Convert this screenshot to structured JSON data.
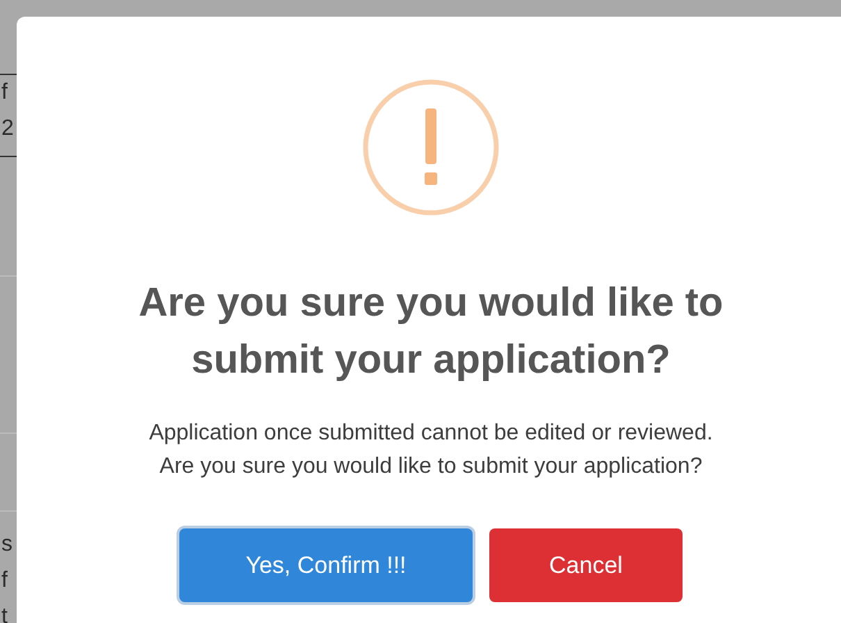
{
  "background_upper_fragments": [
    "f",
    "2"
  ],
  "background_lower_fragments": [
    "s",
    "f",
    "t"
  ],
  "dialog": {
    "title": "Are you sure you would like to submit your application?",
    "message": [
      "Application once submitted cannot be edited or reviewed.",
      "Are you sure you would like to submit your application?"
    ],
    "buttons": [
      {
        "label": "Yes, Confirm !!!",
        "kind": "confirm",
        "focused": true
      },
      {
        "label": "Cancel",
        "kind": "cancel",
        "focused": false
      }
    ]
  }
}
